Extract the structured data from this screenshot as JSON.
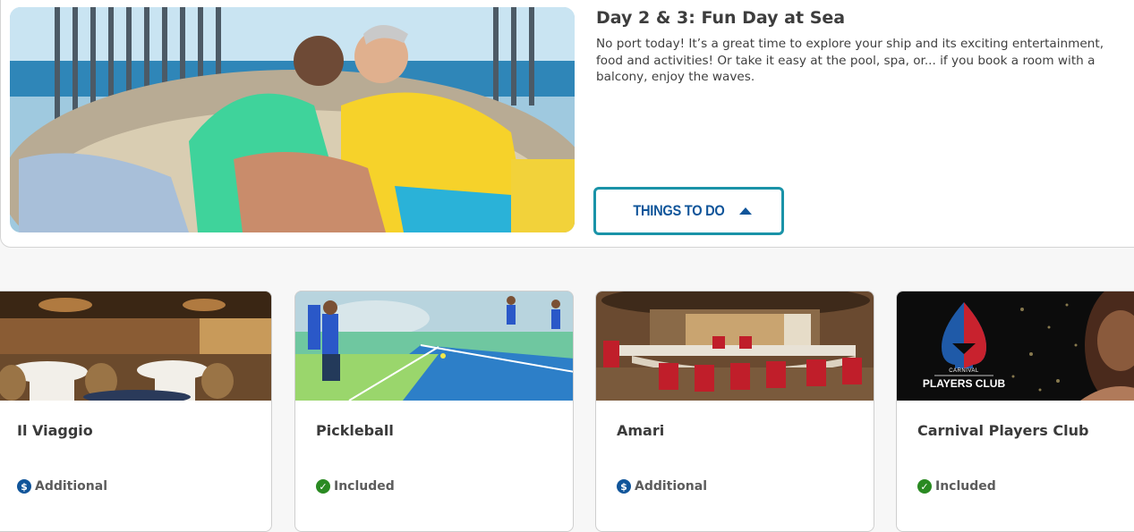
{
  "day": {
    "title": "Day 2 & 3: Fun Day at Sea",
    "description": "No port today! It’s a great time to explore your ship and its exciting entertainment, food and activities! Or take it easy at the pool, spa, or... if you book a room with a balcony, enjoy the waves.",
    "button_label": "THINGS TO DO"
  },
  "activities": [
    {
      "title": "Il Viaggio",
      "status": "Additional",
      "status_icon": "dollar-icon"
    },
    {
      "title": "Pickleball",
      "status": "Included",
      "status_icon": "check-icon"
    },
    {
      "title": "Amari",
      "status": "Additional",
      "status_icon": "dollar-icon"
    },
    {
      "title": "Carnival Players Club",
      "status": "Included",
      "status_icon": "check-icon",
      "logo_text": "CARNIVAL",
      "logo_subtext": "PLAYERS CLUB"
    }
  ],
  "colors": {
    "accent_teal": "#1a93a8",
    "brand_blue": "#10559a",
    "included_green": "#2a8a22"
  }
}
